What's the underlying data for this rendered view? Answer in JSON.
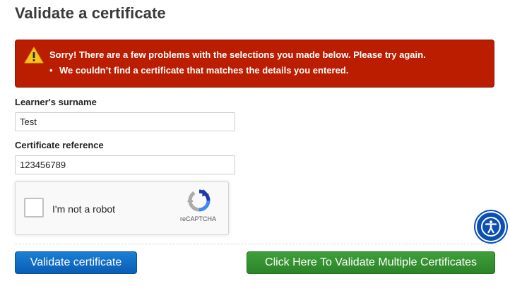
{
  "page": {
    "title": "Validate a certificate"
  },
  "error": {
    "heading": "Sorry! There are a few problems with the selections you made below. Please try again.",
    "items": [
      "We couldn’t find a certificate that matches the details you entered."
    ],
    "icon": "warning-icon",
    "background_color": "#bb1d00"
  },
  "form": {
    "surname_label": "Learner's surname",
    "surname_value": "Test",
    "reference_label": "Certificate reference",
    "reference_value": "123456789"
  },
  "recaptcha": {
    "label": "I'm not a robot",
    "brand": "reCAPTCHA",
    "checked": false
  },
  "buttons": {
    "validate_label": "Validate certificate",
    "validate_multiple_label": "Click Here To Validate Multiple Certificates",
    "validate_color": "#0a5db5",
    "validate_multiple_color": "#2c8429"
  },
  "accessibility": {
    "icon": "accessibility-icon"
  }
}
